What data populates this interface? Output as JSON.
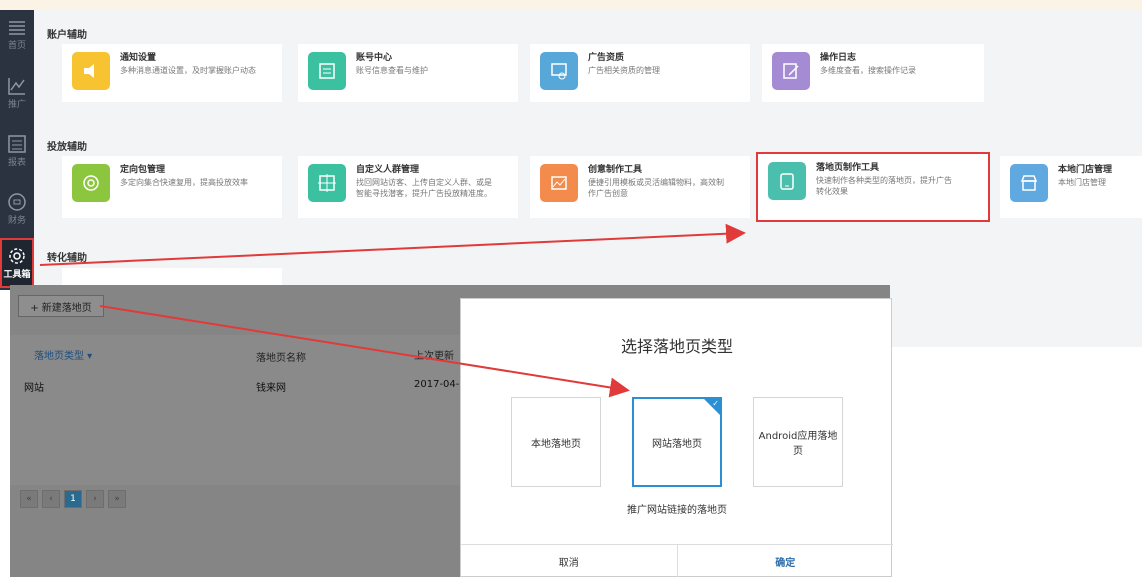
{
  "sidebar": {
    "items": [
      {
        "label": "首页",
        "icon": "menu-icon"
      },
      {
        "label": "推广",
        "icon": "line-chart-icon"
      },
      {
        "label": "报表",
        "icon": "report-icon"
      },
      {
        "label": "财务",
        "icon": "finance-icon"
      },
      {
        "label": "工具箱",
        "icon": "gear-icon"
      }
    ]
  },
  "sections": {
    "account": "账户辅助",
    "delivery": "投放辅助",
    "conversion": "转化辅助"
  },
  "cards": {
    "notify": {
      "title": "通知设置",
      "desc": "多种消息通道设置，及时掌握账户动态"
    },
    "account_center": {
      "title": "账号中心",
      "desc": "账号信息查看与维护"
    },
    "ad_qualification": {
      "title": "广告资质",
      "desc": "广告相关资质的管理"
    },
    "oplog": {
      "title": "操作日志",
      "desc": "多维度查看，搜索操作记录"
    },
    "targeting": {
      "title": "定向包管理",
      "desc": "多定向集合快速复用，提高投放效率"
    },
    "audience": {
      "title": "自定义人群管理",
      "desc1": "找回网站访客、上传自定义人群、或是",
      "desc2": "智能寻找潜客，提升广告投放精准度。"
    },
    "creative": {
      "title": "创意制作工具",
      "desc1": "便捷引用模板或灵活编辑物料，高效制",
      "desc2": "作广告创意"
    },
    "landing": {
      "title": "落地页制作工具",
      "desc1": "快速制作各种类型的落地页，提升广告",
      "desc2": "转化效果"
    },
    "local_store": {
      "title": "本地门店管理",
      "desc": "本地门店管理"
    }
  },
  "landing_list": {
    "new_button": "+ 新建落地页",
    "headers": {
      "type": "落地页类型 ▾",
      "name": "落地页名称",
      "updated": "上次更新"
    },
    "row": {
      "type": "网站",
      "name": "钱来网",
      "updated": "2017-04-"
    },
    "pager": [
      "«",
      "‹",
      "1",
      "›",
      "»"
    ]
  },
  "modal": {
    "title": "选择落地页类型",
    "options": [
      "本地落地页",
      "网站落地页",
      "Android应用落地页"
    ],
    "selected_index": 1,
    "hint": "推广网站链接的落地页",
    "cancel": "取消",
    "confirm": "确定"
  },
  "colors": {
    "highlight": "#e03a3a",
    "selected": "#2b8fd4",
    "sidebar": "#2b3340"
  }
}
